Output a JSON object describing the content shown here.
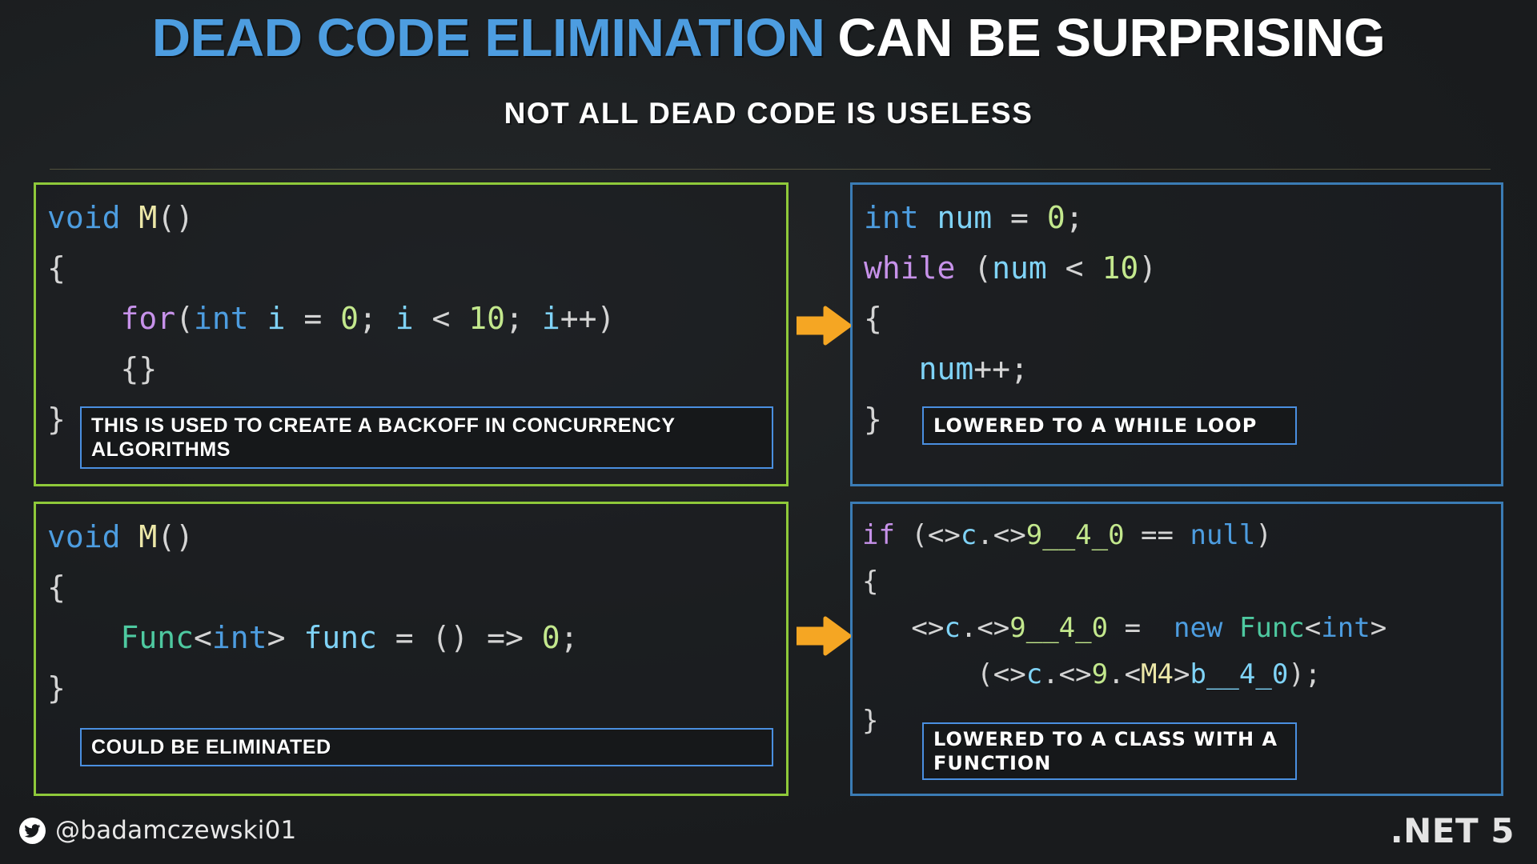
{
  "header": {
    "title_accent": "DEAD CODE ELIMINATION",
    "title_rest": "CAN BE SURPRISING",
    "subtitle": "NOT ALL DEAD CODE IS USELESS"
  },
  "colors": {
    "accent_blue": "#4d9de0",
    "panel_green": "#8fc93a",
    "panel_blue": "#3b7cb5",
    "callout_border": "#4a8fe0",
    "arrow_orange": "#f5a623",
    "background": "#1e2124"
  },
  "panels": [
    {
      "id": "top-left",
      "border_color": "#8fc93a",
      "code_lines": [
        [
          {
            "t": "void",
            "c": "k-type"
          },
          {
            "t": " ",
            "c": "k-punc"
          },
          {
            "t": "M",
            "c": "k-meth"
          },
          {
            "t": "()",
            "c": "k-punc"
          }
        ],
        [
          {
            "t": "{",
            "c": "k-punc"
          }
        ],
        [
          {
            "t": "    ",
            "c": "k-punc"
          },
          {
            "t": "for",
            "c": "k-key"
          },
          {
            "t": "(",
            "c": "k-punc"
          },
          {
            "t": "int",
            "c": "k-type"
          },
          {
            "t": " ",
            "c": "k-punc"
          },
          {
            "t": "i",
            "c": "k-var"
          },
          {
            "t": " = ",
            "c": "k-punc"
          },
          {
            "t": "0",
            "c": "k-num"
          },
          {
            "t": "; ",
            "c": "k-punc"
          },
          {
            "t": "i",
            "c": "k-var"
          },
          {
            "t": " < ",
            "c": "k-punc"
          },
          {
            "t": "10",
            "c": "k-num"
          },
          {
            "t": "; ",
            "c": "k-punc"
          },
          {
            "t": "i",
            "c": "k-var"
          },
          {
            "t": "++)",
            "c": "k-punc"
          }
        ],
        [
          {
            "t": "    {}",
            "c": "k-punc"
          }
        ],
        [
          {
            "t": "}",
            "c": "k-punc"
          }
        ]
      ],
      "callout": "THIS IS USED TO CREATE A BACKOFF IN CONCURRENCY ALGORITHMS"
    },
    {
      "id": "top-right",
      "border_color": "#3b7cb5",
      "code_lines": [
        [
          {
            "t": "int",
            "c": "k-type"
          },
          {
            "t": " ",
            "c": "k-punc"
          },
          {
            "t": "num",
            "c": "k-var"
          },
          {
            "t": " = ",
            "c": "k-punc"
          },
          {
            "t": "0",
            "c": "k-num"
          },
          {
            "t": ";",
            "c": "k-punc"
          }
        ],
        [
          {
            "t": "while",
            "c": "k-key"
          },
          {
            "t": " (",
            "c": "k-punc"
          },
          {
            "t": "num",
            "c": "k-var"
          },
          {
            "t": " < ",
            "c": "k-punc"
          },
          {
            "t": "10",
            "c": "k-num"
          },
          {
            "t": ")",
            "c": "k-punc"
          }
        ],
        [
          {
            "t": "{",
            "c": "k-punc"
          }
        ],
        [
          {
            "t": "   ",
            "c": "k-punc"
          },
          {
            "t": "num",
            "c": "k-var"
          },
          {
            "t": "++;",
            "c": "k-punc"
          }
        ],
        [
          {
            "t": "}",
            "c": "k-punc"
          }
        ]
      ],
      "callout": "LOWERED TO A WHILE LOOP"
    },
    {
      "id": "bottom-left",
      "border_color": "#8fc93a",
      "code_lines": [
        [
          {
            "t": "void",
            "c": "k-type"
          },
          {
            "t": " ",
            "c": "k-punc"
          },
          {
            "t": "M",
            "c": "k-meth"
          },
          {
            "t": "()",
            "c": "k-punc"
          }
        ],
        [
          {
            "t": "{",
            "c": "k-punc"
          }
        ],
        [
          {
            "t": "    ",
            "c": "k-punc"
          },
          {
            "t": "Func",
            "c": "k-class"
          },
          {
            "t": "<",
            "c": "k-punc"
          },
          {
            "t": "int",
            "c": "k-type"
          },
          {
            "t": "> ",
            "c": "k-punc"
          },
          {
            "t": "func",
            "c": "k-var"
          },
          {
            "t": " = () => ",
            "c": "k-punc"
          },
          {
            "t": "0",
            "c": "k-num"
          },
          {
            "t": ";",
            "c": "k-punc"
          }
        ],
        [
          {
            "t": "}",
            "c": "k-punc"
          }
        ]
      ],
      "callout": "COULD BE ELIMINATED"
    },
    {
      "id": "bottom-right",
      "border_color": "#3b7cb5",
      "code_lines": [
        [
          {
            "t": "if",
            "c": "k-key"
          },
          {
            "t": " (<>",
            "c": "k-punc"
          },
          {
            "t": "c",
            "c": "k-var"
          },
          {
            "t": ".<>",
            "c": "k-punc"
          },
          {
            "t": "9__4_0",
            "c": "k-num"
          },
          {
            "t": " == ",
            "c": "k-punc"
          },
          {
            "t": "null",
            "c": "k-type"
          },
          {
            "t": ")",
            "c": "k-punc"
          }
        ],
        [
          {
            "t": "{",
            "c": "k-punc"
          }
        ],
        [
          {
            "t": "   <>",
            "c": "k-punc"
          },
          {
            "t": "c",
            "c": "k-var"
          },
          {
            "t": ".<>",
            "c": "k-punc"
          },
          {
            "t": "9__4_0",
            "c": "k-num"
          },
          {
            "t": " =  ",
            "c": "k-punc"
          },
          {
            "t": "new",
            "c": "k-type"
          },
          {
            "t": " ",
            "c": "k-punc"
          },
          {
            "t": "Func",
            "c": "k-class"
          },
          {
            "t": "<",
            "c": "k-punc"
          },
          {
            "t": "int",
            "c": "k-type"
          },
          {
            "t": ">",
            "c": "k-punc"
          }
        ],
        [
          {
            "t": "       (<>",
            "c": "k-punc"
          },
          {
            "t": "c",
            "c": "k-var"
          },
          {
            "t": ".<>",
            "c": "k-punc"
          },
          {
            "t": "9",
            "c": "k-num"
          },
          {
            "t": ".<",
            "c": "k-punc"
          },
          {
            "t": "M4",
            "c": "k-meth"
          },
          {
            "t": ">",
            "c": "k-punc"
          },
          {
            "t": "b__4_0",
            "c": "k-var"
          },
          {
            "t": ");",
            "c": "k-punc"
          }
        ],
        [
          {
            "t": "}",
            "c": "k-punc"
          }
        ]
      ],
      "callout": "LOWERED TO A CLASS WITH A FUNCTION"
    }
  ],
  "arrows": [
    {
      "id": "arrow-top",
      "direction": "right"
    },
    {
      "id": "arrow-bottom",
      "direction": "right"
    }
  ],
  "footer": {
    "twitter_icon": "twitter-bird-icon",
    "handle": "@badamczewski01",
    "framework": ".NET 5"
  }
}
